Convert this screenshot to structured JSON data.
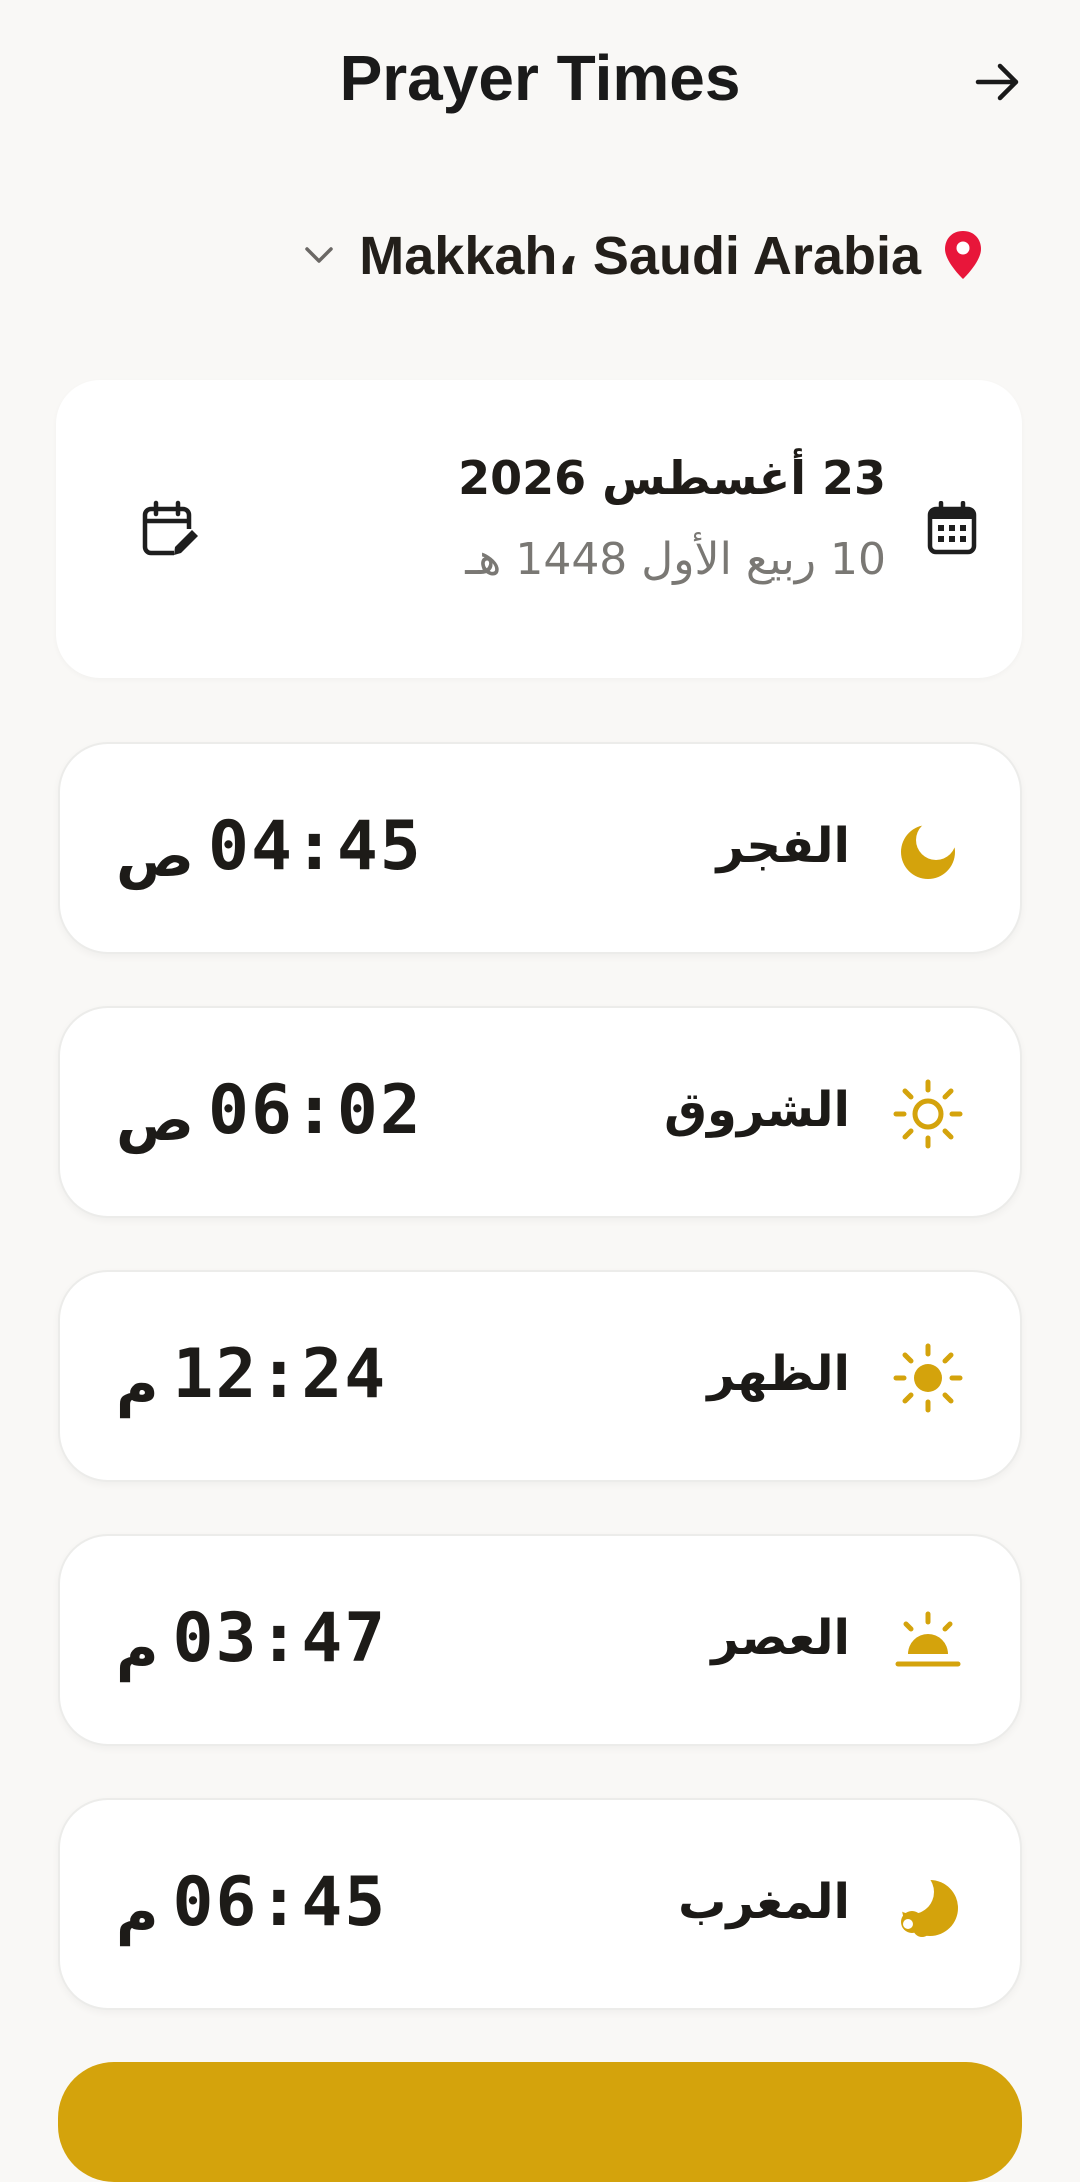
{
  "header": {
    "title": "Prayer Times",
    "forward_icon": "arrow-right-icon"
  },
  "location": {
    "name": "Makkah، Saudi Arabia",
    "pin_color": "#e8163a"
  },
  "date_card": {
    "gregorian": "23 أغسطس 2026",
    "hijri": "10 ربيع الأول 1448 هـ"
  },
  "accent_color": "#d4a30c",
  "prayers": [
    {
      "name": "الفجر",
      "time": "04:45",
      "period": "ص",
      "icon": "moon-icon"
    },
    {
      "name": "الشروق",
      "time": "06:02",
      "period": "ص",
      "icon": "sunrise-icon"
    },
    {
      "name": "الظهر",
      "time": "12:24",
      "period": "م",
      "icon": "sun-icon"
    },
    {
      "name": "العصر",
      "time": "03:47",
      "period": "م",
      "icon": "sunset-horizon-icon"
    },
    {
      "name": "المغرب",
      "time": "06:45",
      "period": "م",
      "icon": "crescent-cloud-icon"
    }
  ]
}
